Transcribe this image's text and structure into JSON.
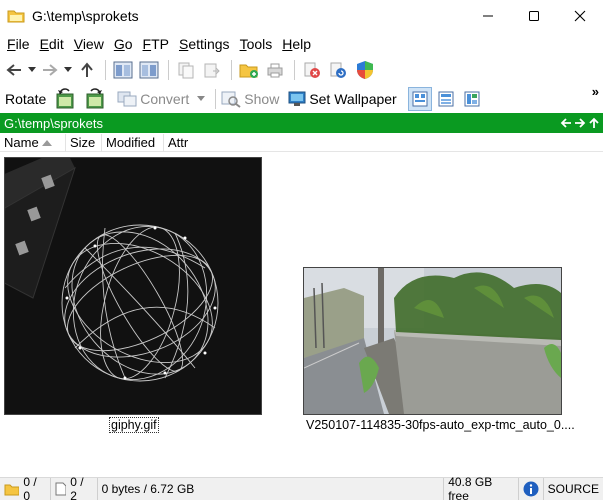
{
  "window": {
    "title": "G:\\temp\\sprokets",
    "minimize": "minimize",
    "maximize": "maximize",
    "close": "close"
  },
  "menu": [
    {
      "pre": "",
      "ul": "F",
      "post": "ile"
    },
    {
      "pre": "",
      "ul": "E",
      "post": "dit"
    },
    {
      "pre": "",
      "ul": "V",
      "post": "iew"
    },
    {
      "pre": "",
      "ul": "G",
      "post": "o"
    },
    {
      "pre": "",
      "ul": "F",
      "post": "TP"
    },
    {
      "pre": "",
      "ul": "S",
      "post": "ettings"
    },
    {
      "pre": "",
      "ul": "T",
      "post": "ools"
    },
    {
      "pre": "",
      "ul": "H",
      "post": "elp"
    }
  ],
  "toolbar2": {
    "rotate": "Rotate",
    "convert": "Convert",
    "show": "Show",
    "set_wallpaper": "Set Wallpaper",
    "overflow": "»"
  },
  "path": "G:\\temp\\sprokets",
  "columns": [
    "Name",
    "Size",
    "Modified",
    "Attr"
  ],
  "files": [
    {
      "name": "giphy.gif"
    },
    {
      "name": "V250107-114835-30fps-auto_exp-tmc_auto_0...."
    }
  ],
  "status": {
    "folders": "0 / 0",
    "files": "0 / 2",
    "bytes": "0 bytes / 6.72 GB",
    "free": "40.8 GB free",
    "source": "SOURCE"
  },
  "colors": {
    "path_bar": "#0a9a21",
    "accent_blue": "#1f5fbf"
  }
}
